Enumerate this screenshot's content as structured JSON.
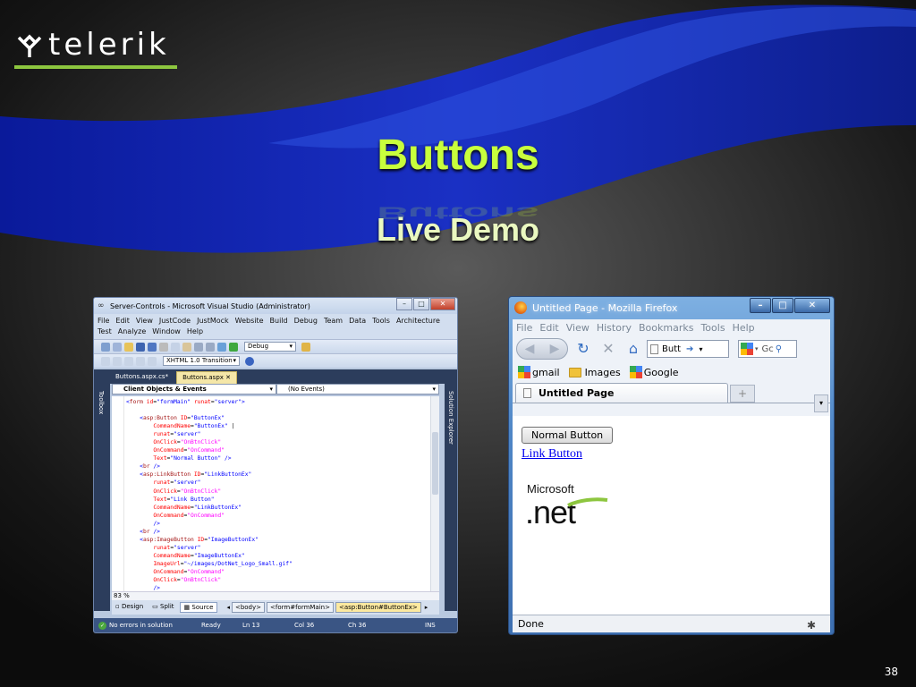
{
  "slide": {
    "logo_text": "telerik",
    "title": "Buttons",
    "subtitle": "Live Demo",
    "page_number": "38"
  },
  "colors": {
    "title": "#c8ff3c",
    "logo_underline": "#8dc63f",
    "swoosh": "#1a2fb0"
  },
  "vs": {
    "title": "Server-Controls - Microsoft Visual Studio (Administrator)",
    "menu": [
      "File",
      "Edit",
      "View",
      "JustCode",
      "JustMock",
      "Website",
      "Build",
      "Debug",
      "Team",
      "Data",
      "Tools",
      "Architecture",
      "Test",
      "Analyze",
      "Window",
      "Help"
    ],
    "config": "Debug",
    "doctype": "XHTML 1.0 Transition",
    "tabs": [
      "Buttons.aspx.cs*",
      "Buttons.aspx"
    ],
    "toolbox_label": "Toolbox",
    "solution_label": "Solution Explorer",
    "dropdown_left": "Client Objects & Events",
    "dropdown_right": "(No Events)",
    "zoom": "83 %",
    "views": [
      "Design",
      "Split",
      "Source"
    ],
    "breadcrumbs": [
      "<body>",
      "<form#formMain>",
      "<asp:Button#ButtonEx>"
    ],
    "status": {
      "message": "No errors in solution",
      "ready": "Ready",
      "line": "Ln 13",
      "col": "Col 36",
      "ch": "Ch 36",
      "mode": "INS"
    }
  },
  "ff": {
    "title": "Untitled Page - Mozilla Firefox",
    "menu": [
      "File",
      "Edit",
      "View",
      "History",
      "Bookmarks",
      "Tools",
      "Help"
    ],
    "url": "Butt",
    "search": "Gc",
    "bookmarks": [
      "gmail",
      "Images",
      "Google"
    ],
    "tab": "Untitled Page",
    "newtab": "+",
    "normal_button": "Normal Button",
    "link_button": "Link Button",
    "logo_top": "Microsoft",
    "logo_net": ".net",
    "status": "Done"
  }
}
